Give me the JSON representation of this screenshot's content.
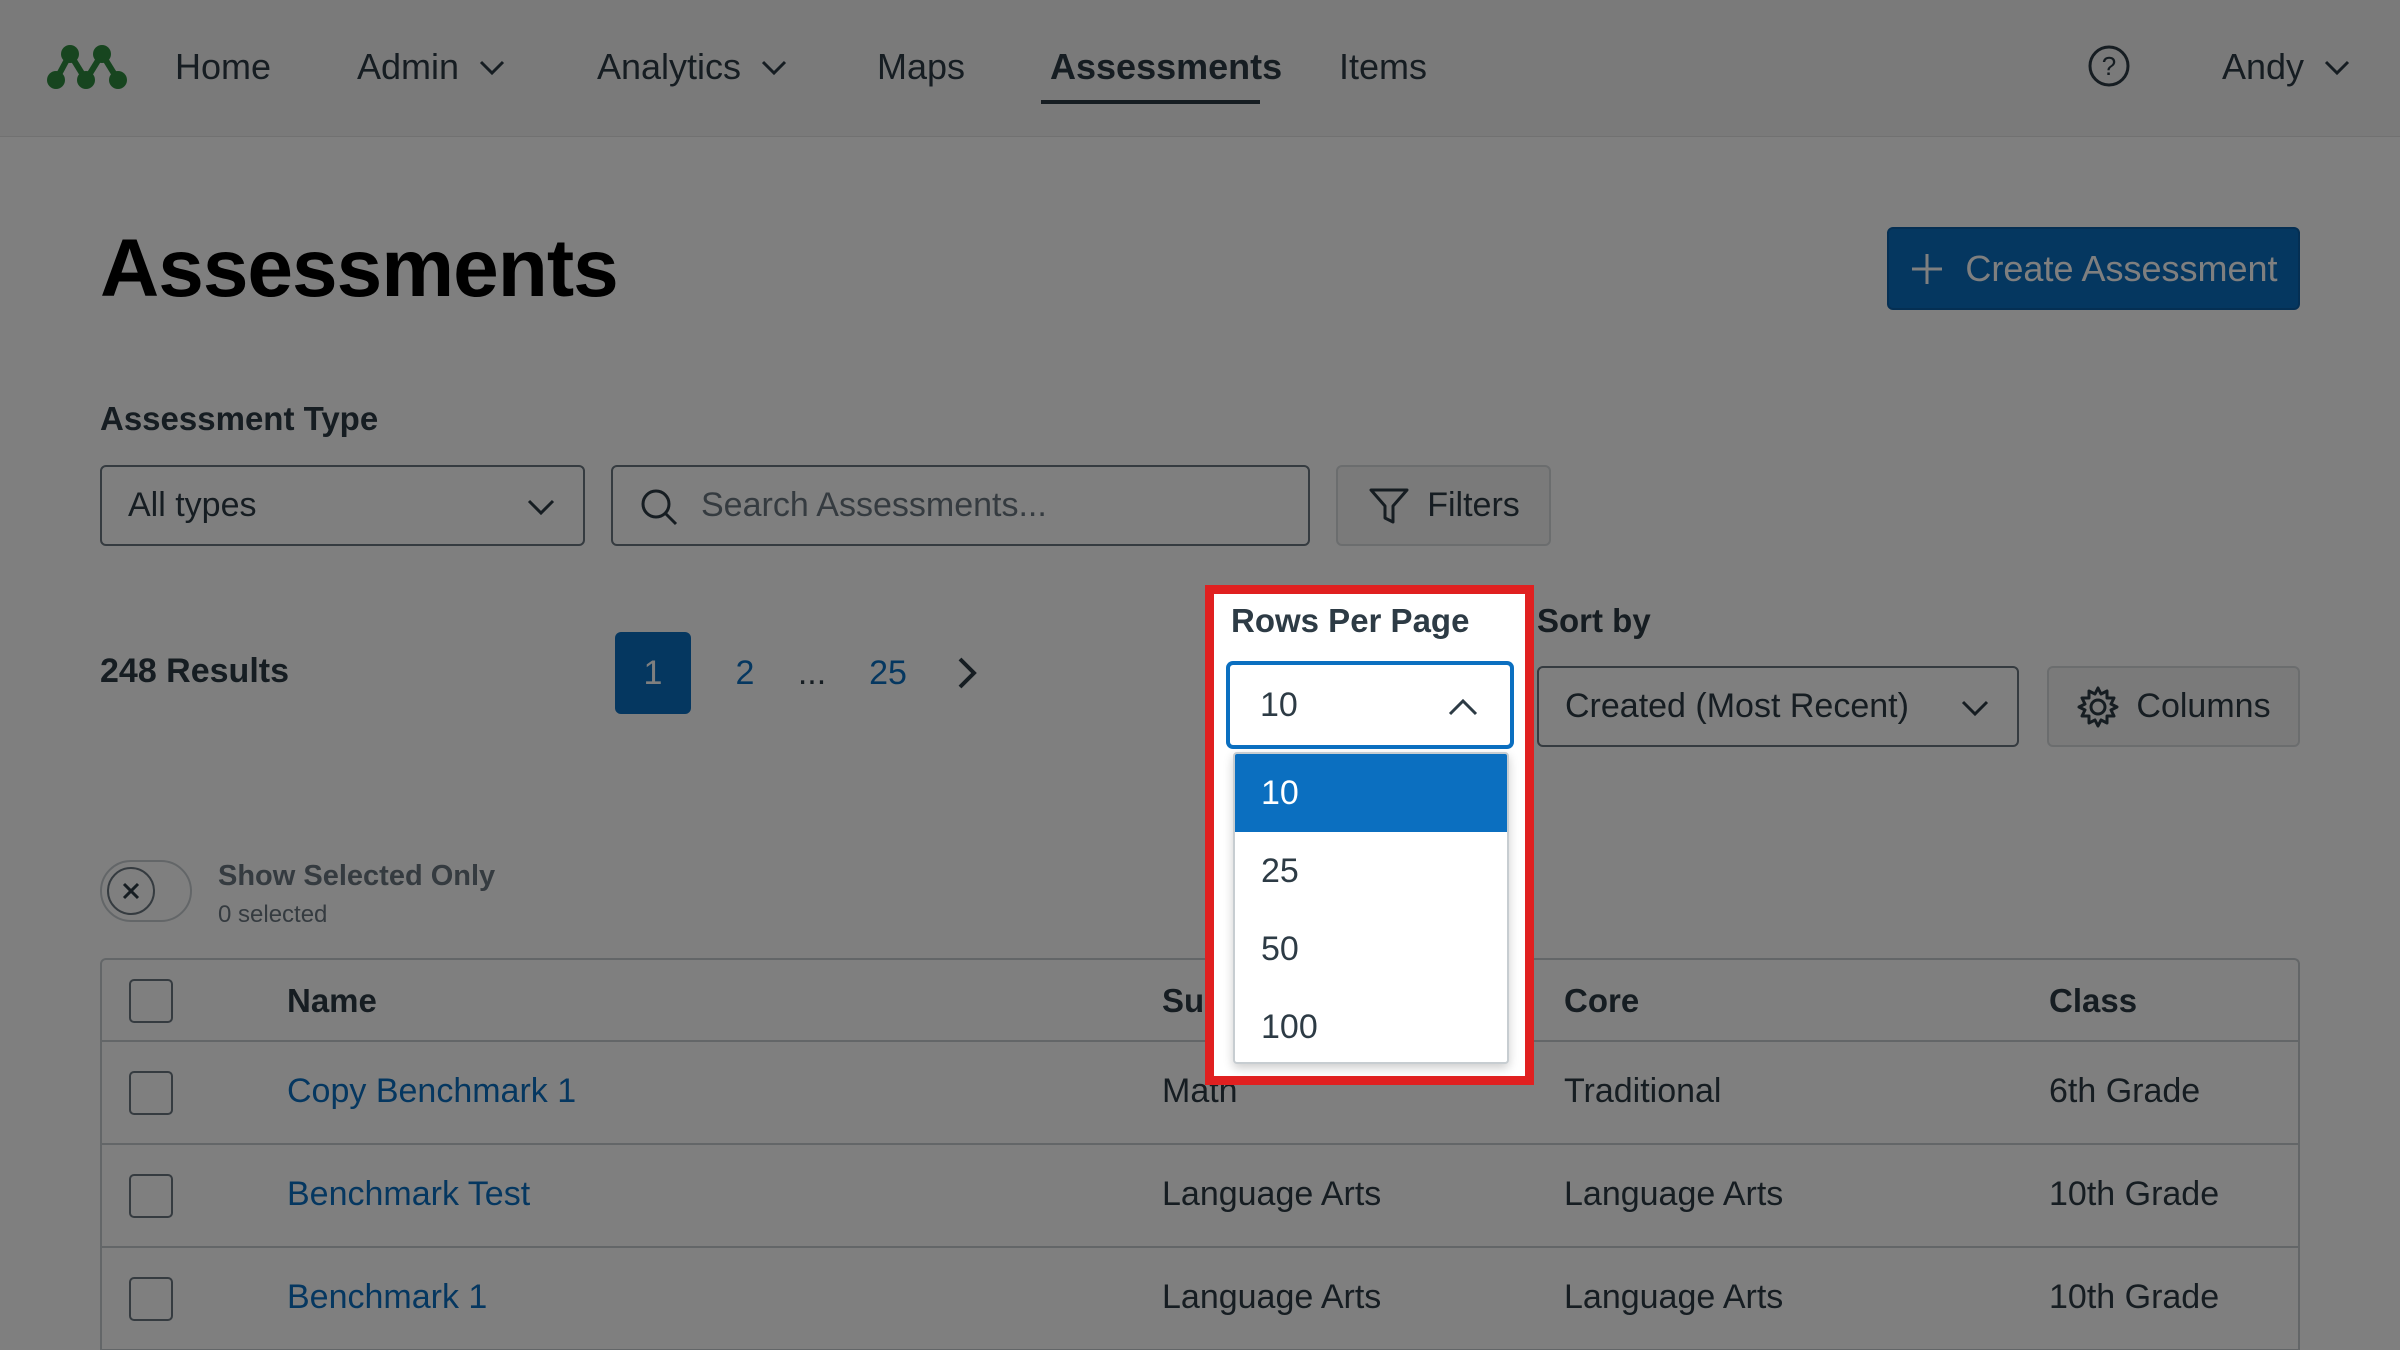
{
  "nav": {
    "items": [
      {
        "label": "Home",
        "has_menu": false
      },
      {
        "label": "Admin",
        "has_menu": true
      },
      {
        "label": "Analytics",
        "has_menu": true
      },
      {
        "label": "Maps",
        "has_menu": false
      },
      {
        "label": "Assessments",
        "has_menu": false,
        "active": true
      },
      {
        "label": "Items",
        "has_menu": false
      }
    ],
    "user": "Andy",
    "help_icon": "question-circle-icon"
  },
  "page": {
    "title": "Assessments",
    "create_button": "Create Assessment"
  },
  "filters": {
    "type_label": "Assessment Type",
    "type_value": "All types",
    "search_placeholder": "Search Assessments...",
    "filters_button": "Filters"
  },
  "results": {
    "count_text": "248 Results",
    "pagination": {
      "current": "1",
      "pages": [
        "1",
        "2",
        "...",
        "25"
      ]
    }
  },
  "rows_per_page": {
    "label": "Rows Per Page",
    "value": "10",
    "options": [
      "10",
      "25",
      "50",
      "100"
    ],
    "selected": "10"
  },
  "sort": {
    "label": "Sort by",
    "value": "Created (Most Recent)"
  },
  "columns_button": "Columns",
  "show_selected": {
    "label": "Show Selected Only",
    "sub": "0 selected"
  },
  "table": {
    "headers": {
      "name": "Name",
      "subject": "Subject",
      "core": "Core",
      "class": "Class"
    },
    "rows": [
      {
        "name": "Copy Benchmark 1",
        "subject": "Math",
        "core": "Traditional",
        "class": "6th Grade"
      },
      {
        "name": "Benchmark Test",
        "subject": "Language Arts",
        "core": "Language Arts",
        "class": "10th Grade"
      },
      {
        "name": "Benchmark 1",
        "subject": "Language Arts",
        "core": "Language Arts",
        "class": "10th Grade"
      }
    ]
  },
  "colors": {
    "brand_green": "#2e8b3e",
    "primary_blue": "#0b6fc0",
    "highlight_red": "#e02020",
    "text": "#2d3b45"
  }
}
